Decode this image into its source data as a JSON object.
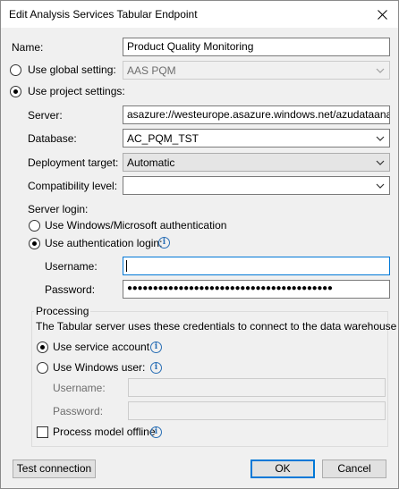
{
  "window": {
    "title": "Edit Analysis Services Tabular Endpoint",
    "close_icon": "close-icon"
  },
  "name": {
    "label": "Name:",
    "value": "Product Quality Monitoring"
  },
  "global_setting": {
    "label": "Use global setting:",
    "value": "AAS PQM",
    "selected": false
  },
  "project_settings": {
    "label": "Use project settings:",
    "selected": true
  },
  "server": {
    "label": "Server:",
    "value": "asazure://westeurope.asazure.windows.net/azudataanalytics"
  },
  "database": {
    "label": "Database:",
    "value": "AC_PQM_TST"
  },
  "deployment_target": {
    "label": "Deployment target:",
    "value": "Automatic"
  },
  "compatibility_level": {
    "label": "Compatibility level:",
    "value": ""
  },
  "server_login": {
    "label": "Server login:",
    "windows_auth_label": "Use Windows/Microsoft authentication",
    "auth_login_label": "Use authentication login:",
    "selected": "auth_login",
    "username_label": "Username:",
    "username_value": "",
    "password_label": "Password:",
    "password_value": "●●●●●●●●●●●●●●●●●●●●●●●●●●●●●●●●●●●●●●●●"
  },
  "processing": {
    "title": "Processing",
    "description": "The Tabular server uses these credentials to connect to the data warehouse",
    "service_account_label": "Use service account",
    "windows_user_label": "Use Windows user:",
    "selected": "service_account",
    "username_label": "Username:",
    "password_label": "Password:",
    "offline_label": "Process model offline",
    "offline_checked": false
  },
  "buttons": {
    "test_connection": "Test connection",
    "ok": "OK",
    "cancel": "Cancel"
  }
}
